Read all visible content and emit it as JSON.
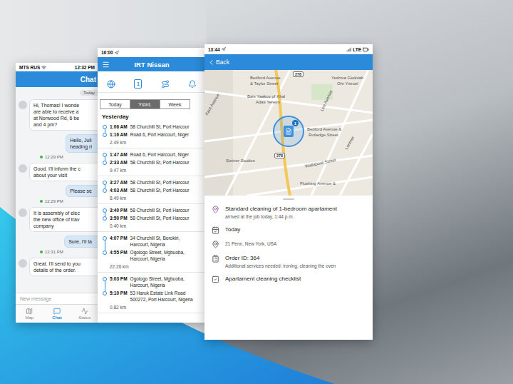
{
  "chat_screen": {
    "status_bar": {
      "carrier": "MTS RUS",
      "time": "12:32 PM"
    },
    "title": "Chat",
    "date_badge": "Today",
    "messages": [
      {
        "kind": "incoming",
        "lines": [
          "Hi, Thomas! I wonde",
          "are able to receive a",
          "at Norwood Rd, 6 be",
          "and 4 pm?"
        ]
      },
      {
        "kind": "outgoing",
        "lines": [
          "Hello, Juli",
          "heading ri"
        ],
        "time": "12:29 PM"
      },
      {
        "kind": "incoming",
        "lines": [
          "Good. I'll inform the c",
          "about your visit"
        ]
      },
      {
        "kind": "outgoing",
        "lines": [
          "Please se"
        ],
        "time": "12:29 PM"
      },
      {
        "kind": "incoming",
        "lines": [
          "It is assembly of elec",
          "the new office of trav",
          "company"
        ]
      },
      {
        "kind": "outgoing",
        "lines": [
          "Sure, I'll ta"
        ],
        "time": "12:31 PM"
      },
      {
        "kind": "incoming",
        "lines": [
          "Great. I'll send to you",
          "details of the order."
        ]
      }
    ],
    "input_placeholder": "New message",
    "tabs": [
      {
        "label": "Map",
        "selected": false
      },
      {
        "label": "Chat",
        "selected": true
      },
      {
        "label": "Status",
        "selected": false
      }
    ]
  },
  "trips_screen": {
    "status_bar": {
      "time": "16:00"
    },
    "title": "IRT Nissan",
    "calendar_day": "1",
    "periods": [
      {
        "label": "Today",
        "selected": false
      },
      {
        "label": "Ystrd.",
        "selected": true
      },
      {
        "label": "Week",
        "selected": false
      }
    ],
    "section": "Yesterday",
    "trips": [
      {
        "start": {
          "time": "1:06 AM",
          "address": [
            "58 Churchill St, Port Harcour"
          ]
        },
        "end": {
          "time": "1:16 AM",
          "address": [
            "Road 6, Port Harcourt, Niger"
          ]
        },
        "distance": "2.49 km"
      },
      {
        "start": {
          "time": "1:47 AM",
          "address": [
            "Road 6, Port Harcourt, Niger"
          ]
        },
        "end": {
          "time": "2:33 AM",
          "address": [
            "58 Churchill St, Port Harcour"
          ]
        },
        "distance": "9.47 km"
      },
      {
        "start": {
          "time": "3:27 AM",
          "address": [
            "58 Churchill St, Port Harcour"
          ]
        },
        "end": {
          "time": "4:03 AM",
          "address": [
            "58 Churchill St, Port Harcour"
          ]
        },
        "distance": "8.49 km"
      },
      {
        "start": {
          "time": "3:40 PM",
          "address": [
            "58 Churchill St, Port Harcour"
          ]
        },
        "end": {
          "time": "3:50 PM",
          "address": [
            "58 Churchill St, Port Harcour"
          ]
        },
        "distance": "0.40 km"
      },
      {
        "start": {
          "time": "4:07 PM",
          "address": [
            "34 Churchill St, Borokiri,",
            "Harcourt, Nigeria"
          ]
        },
        "end": {
          "time": "4:55 PM",
          "address": [
            "Ogologo Street, Mgbuoba,",
            "Harcourt, Nigeria"
          ]
        },
        "distance": "22.26 km"
      },
      {
        "start": {
          "time": "5:03 PM",
          "address": [
            "Ogologo Street, Mgbuoba,",
            "Harcourt, Nigeria"
          ]
        },
        "end": {
          "time": "5:10 PM",
          "address": [
            "53 Haruk Estate Link Road",
            "500272, Port Harcourt, Nigeria"
          ]
        },
        "distance": "0.82 km"
      }
    ]
  },
  "order_screen": {
    "status_bar": {
      "time": "13:44",
      "network": "LTE"
    },
    "back": "Back",
    "map": {
      "labels": [
        "Bedford Avenue",
        "& Taylor Street",
        "Yeshiva Gedolah",
        "Ohr Yisroel",
        "Bais Yaakov of Khal",
        "Adas Yereim",
        "Kent Avenue",
        "Lee Avenue",
        "Bedford Avenue &",
        "Rutledge Street",
        "Steiner Studios",
        "Wallabout Street",
        "Flushing Avenue &",
        "Lorimer"
      ],
      "shields": [
        "278",
        "278"
      ],
      "marker_count": "1"
    },
    "details": [
      {
        "kind": "job",
        "title": "Standard cleaning of 1-bedroom apartament",
        "subtitle": "arrived at the job today, 1:44 p.m."
      },
      {
        "kind": "date",
        "title": "Today"
      },
      {
        "kind": "address",
        "title": "21 Penn, New York, USA"
      },
      {
        "kind": "order",
        "title": "Order ID: 364",
        "subtitle": "Additional services needed: ironing, cleaning the oven"
      },
      {
        "kind": "checklist",
        "title": "Apartament cleaning checklist"
      }
    ]
  }
}
